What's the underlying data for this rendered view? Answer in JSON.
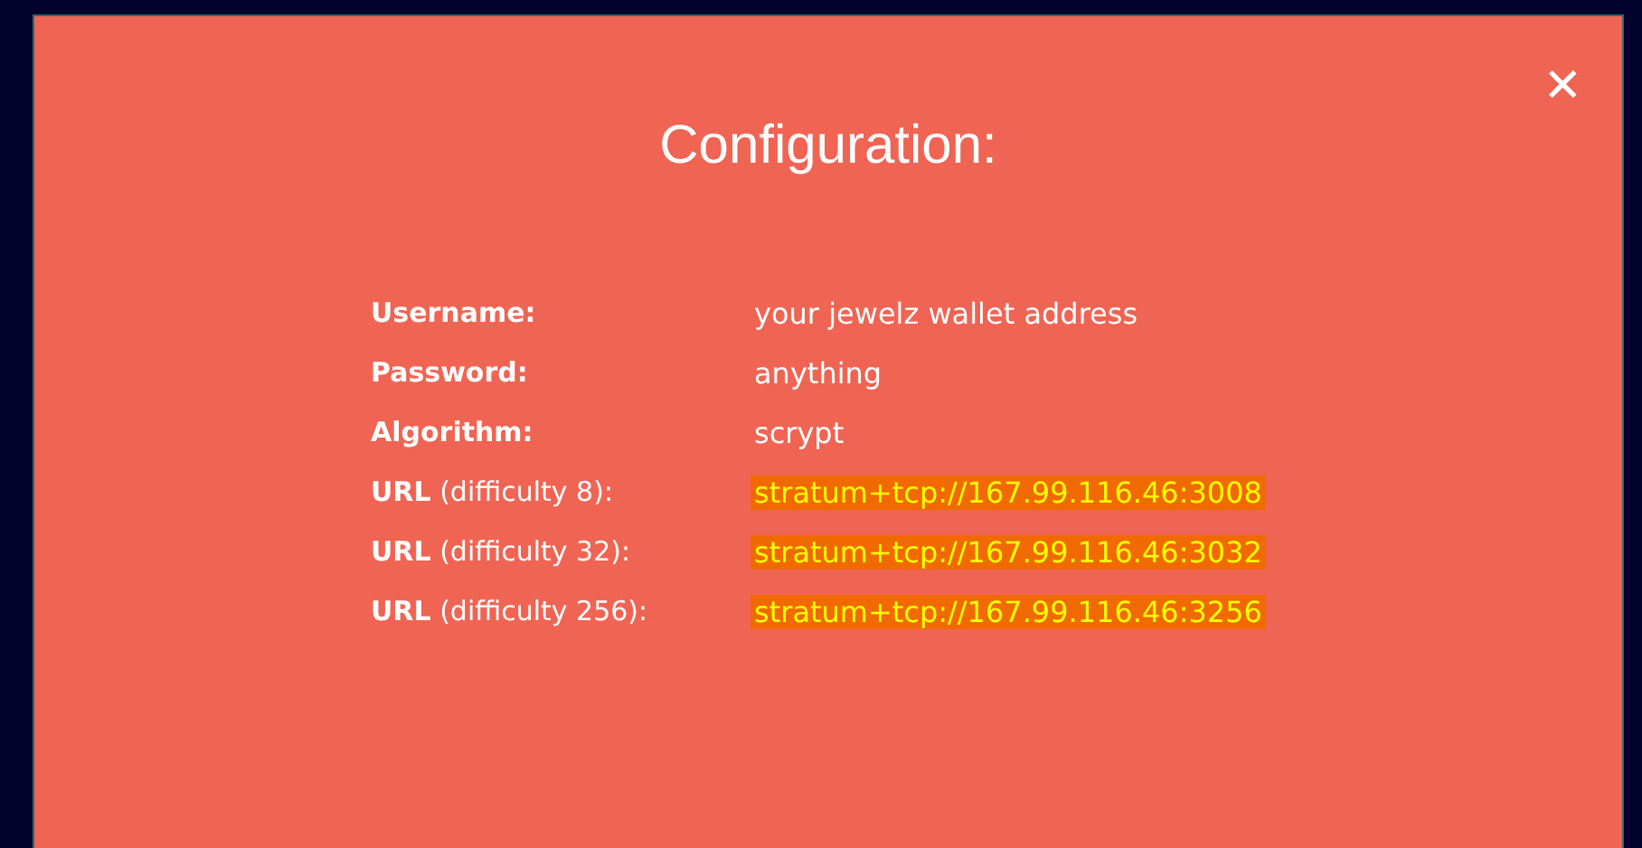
{
  "dialog": {
    "title": "Configuration:",
    "close": "✕",
    "rows": [
      {
        "label": "**Username:**",
        "value": "your jewelz wallet address",
        "highlighted": false
      },
      {
        "label": "**Password:**",
        "value": "anything",
        "highlighted": false
      },
      {
        "label": "**Algorithm:**",
        "value": "scrypt",
        "highlighted": false
      },
      {
        "label": "**URL** (difficulty 8):",
        "value": "stratum+tcp://167.99.116.46:3008",
        "highlighted": true
      },
      {
        "label": "**URL** (difficulty 32):",
        "value": "stratum+tcp://167.99.116.46:3032",
        "highlighted": true
      },
      {
        "label": "**URL** (difficulty 256):",
        "value": "stratum+tcp://167.99.116.46:3256",
        "highlighted": true
      }
    ]
  }
}
